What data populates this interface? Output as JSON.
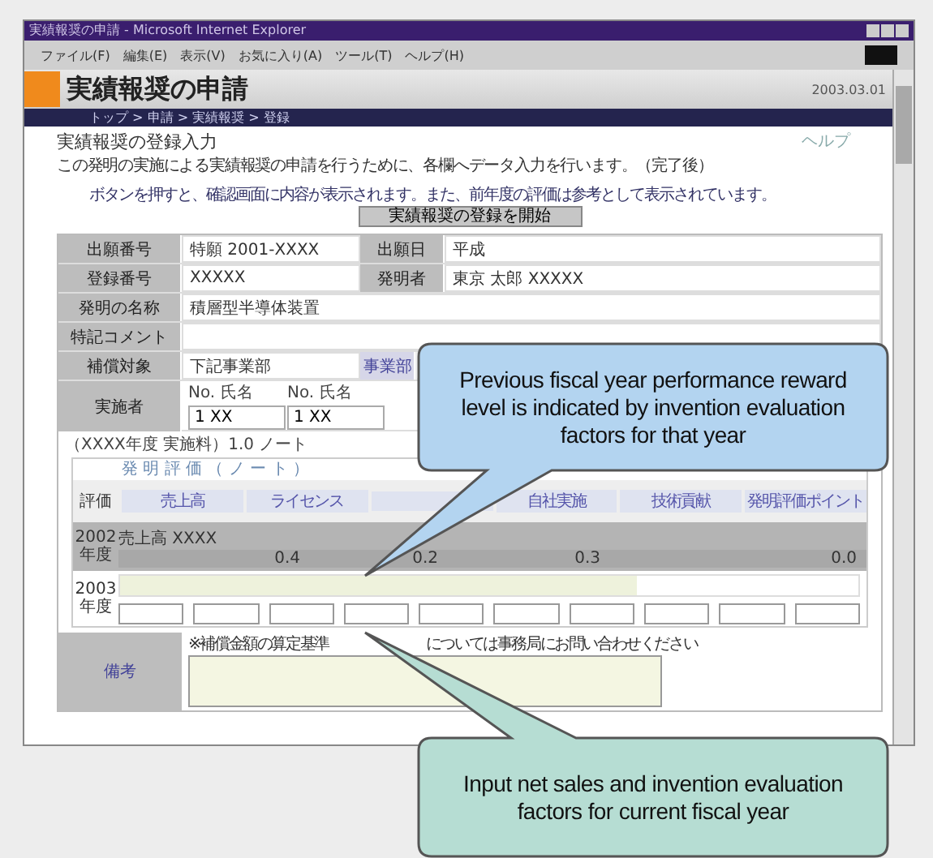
{
  "window": {
    "title": "実績報奨の申請 - Microsoft Internet Explorer"
  },
  "menu": [
    {
      "label": "ファイル(F)"
    },
    {
      "label": "編集(E)"
    },
    {
      "label": "表示(V)"
    },
    {
      "label": "お気に入り(A)"
    },
    {
      "label": "ツール(T)"
    },
    {
      "label": "ヘルプ(H)"
    }
  ],
  "page": {
    "title": "実績報奨の申請",
    "date": "2003.03.01",
    "breadcrumb": "トップ > 申請 > 実績報奨 > 登録"
  },
  "form": {
    "heading": "実績報奨の登録入力",
    "help": "ヘルプ",
    "description": "この発明の実施による実績報奨の申請を行うために、各欄へデータ入力を行います。（完了後）",
    "notice": "ボタンを押すと、確認画面に内容が表示されます。また、前年度の評価は参考として表示されています。",
    "start_button": "実績報奨の登録を開始",
    "info_rows": [
      {
        "kind": "pair",
        "cells": [
          {
            "label": "出願番号",
            "value": "特願 2001-XXXX"
          },
          {
            "label": "出願日",
            "value": "平成"
          }
        ]
      },
      {
        "kind": "pair",
        "cells": [
          {
            "label": "登録番号",
            "value": "XXXXX"
          },
          {
            "label": "発明者",
            "value": "東京 太郎 XXXXX"
          }
        ]
      },
      {
        "kind": "full",
        "cells": [
          {
            "label": "発明の名称",
            "value": "積層型半導体装置"
          }
        ]
      },
      {
        "kind": "full",
        "cells": [
          {
            "label": "特記コメント"
          }
        ]
      },
      {
        "kind": "pair",
        "cells": [
          {
            "label": "補償対象",
            "value": "下記事業部"
          },
          {
            "label": "事業部",
            "kind": "link"
          }
        ]
      }
    ],
    "implementers": {
      "label": "実施者",
      "columns": [
        "No. 氏名",
        "No. 氏名"
      ],
      "values": [
        "1 XX",
        "1 XX"
      ]
    },
    "section_title": "（XXXX年度 実施料）1.0 ノート",
    "factor_title": "発 明 評 価 （ ノ ー ト ）",
    "factor_label": "評価",
    "factor_headers": [
      "売上高",
      "ライセンス",
      "自社実施",
      "技術貢献",
      "発明評価ポイント"
    ],
    "previous": {
      "year": "2002",
      "unit": "年度",
      "note": "売上高 XXXX",
      "values": [
        "0.4",
        "0.2",
        "0.3",
        "0.0"
      ]
    },
    "current": {
      "year": "2003",
      "unit": "年度"
    },
    "remarks": {
      "label": "備考",
      "note": "※補償金額の算定基準",
      "note_2": "については事務局にお問い合わせください"
    }
  },
  "callouts": [
    {
      "text": "Previous fiscal year performance reward level is indicated by invention evaluation factors for that year",
      "color": "#b3d4f0"
    },
    {
      "text": "Input net sales and invention evaluation factors for current fiscal year",
      "color": "#b6ddd3"
    }
  ]
}
